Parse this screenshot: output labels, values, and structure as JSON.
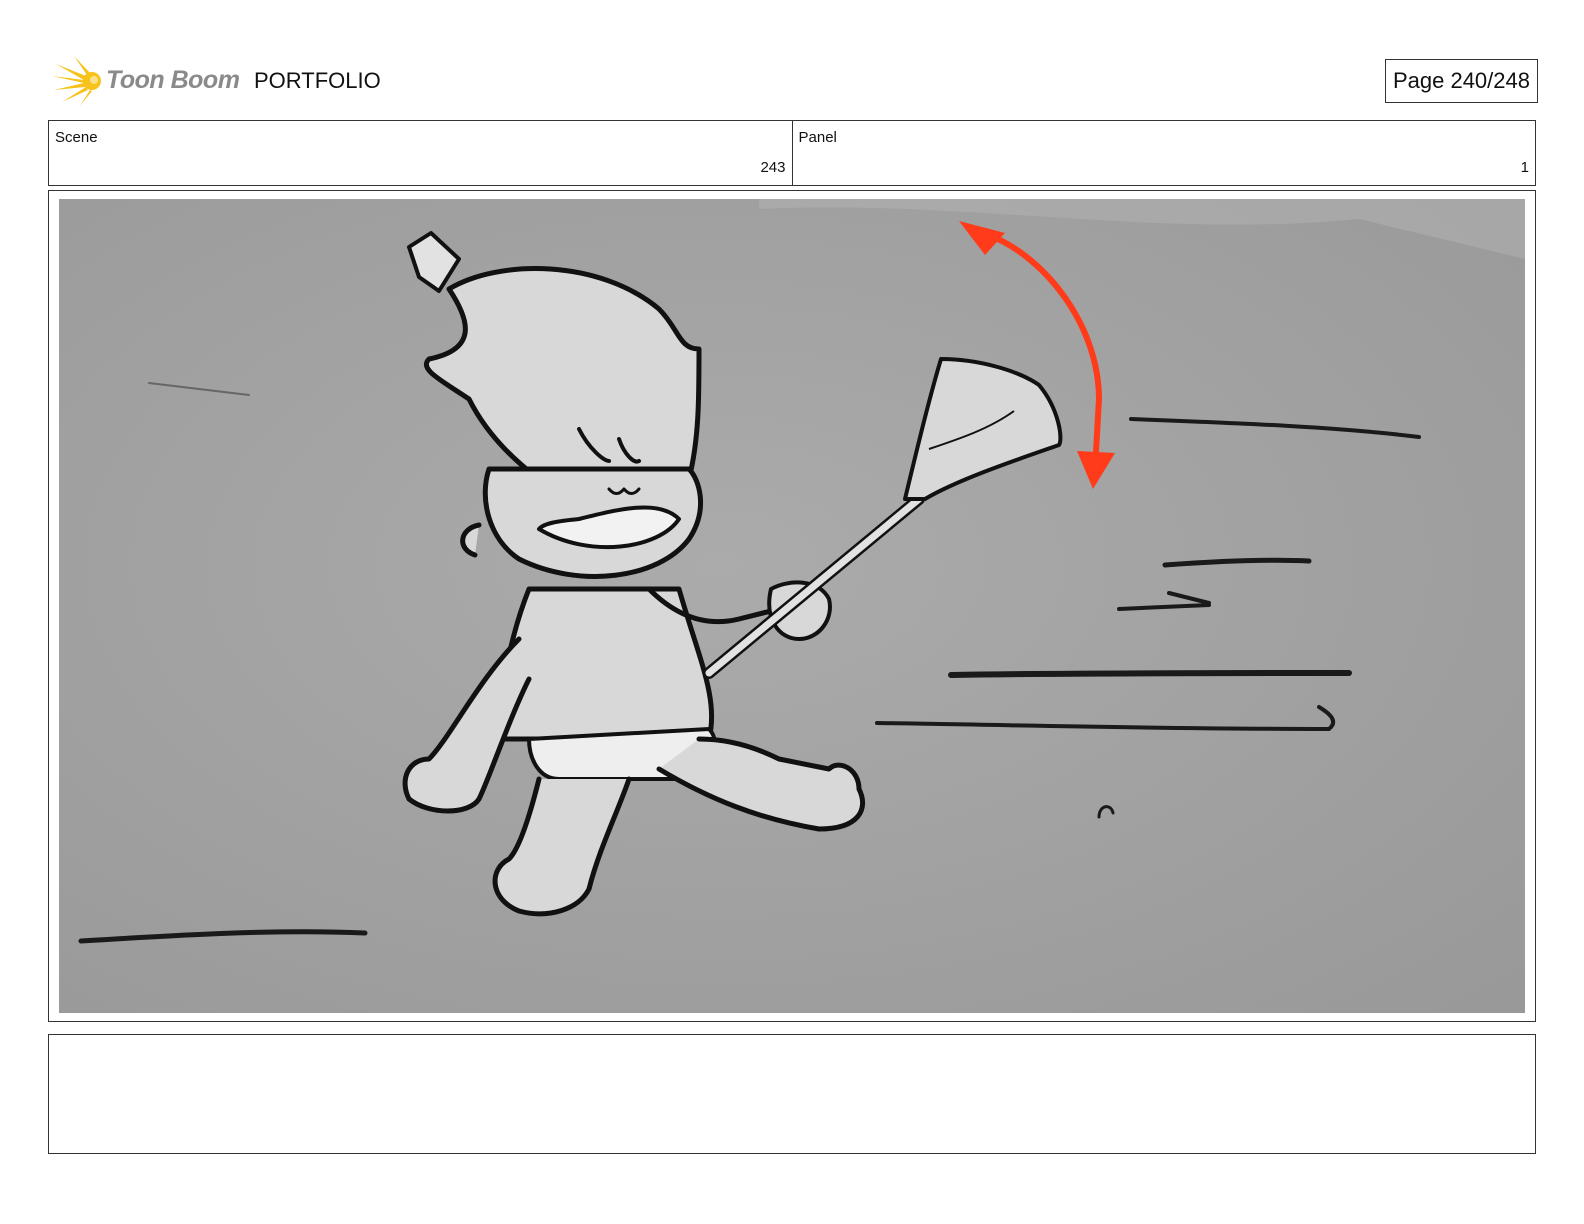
{
  "brand": {
    "logo_text": "Toon Boom",
    "title": "PORTFOLIO"
  },
  "page_indicator": "Page 240/248",
  "scene": {
    "label": "Scene",
    "value": "243"
  },
  "panel": {
    "label": "Panel",
    "value": "1"
  },
  "notes": {
    "text": ""
  },
  "colors": {
    "logo_yellow": "#f6c21b",
    "annotation_red": "#ff3b1a",
    "panel_gray": "#a8a8a8"
  },
  "icons": [
    "toon-boom-logo-icon"
  ]
}
